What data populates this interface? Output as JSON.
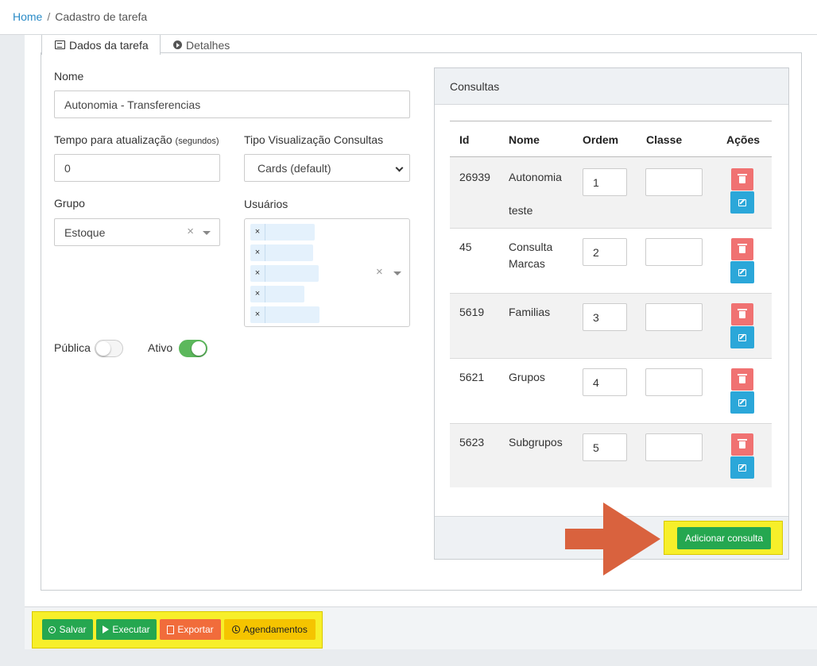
{
  "breadcrumb": {
    "home": "Home",
    "separator": "/",
    "current": "Cadastro de tarefa"
  },
  "tabs": [
    {
      "label": "Dados da tarefa",
      "icon": "list-icon",
      "active": true
    },
    {
      "label": "Detalhes",
      "icon": "play-circle-icon",
      "active": false
    }
  ],
  "form": {
    "nome_label": "Nome",
    "nome_value": "Autonomia - Transferencias",
    "tempo_label": "Tempo para atualização",
    "tempo_hint": "(segundos)",
    "tempo_value": "0",
    "tipo_label": "Tipo Visualização Consultas",
    "tipo_value": "Cards (default)",
    "grupo_label": "Grupo",
    "grupo_value": "Estoque",
    "usuarios_label": "Usuários",
    "usuarios": [
      "",
      "",
      "",
      "",
      ""
    ],
    "publica_label": "Pública",
    "publica_on": false,
    "ativo_label": "Ativo",
    "ativo_on": true
  },
  "consultas": {
    "title": "Consultas",
    "columns": [
      "Id",
      "Nome",
      "Ordem",
      "Classe",
      "Ações"
    ],
    "rows": [
      {
        "id": "26939",
        "nome": "Autonomia",
        "nome2": "teste",
        "ordem": "1",
        "classe": ""
      },
      {
        "id": "45",
        "nome": "Consulta",
        "nome2": "Marcas",
        "ordem": "2",
        "classe": ""
      },
      {
        "id": "5619",
        "nome": "Familias",
        "nome2": "",
        "ordem": "3",
        "classe": ""
      },
      {
        "id": "5621",
        "nome": "Grupos",
        "nome2": "",
        "ordem": "4",
        "classe": ""
      },
      {
        "id": "5623",
        "nome": "Subgrupos",
        "nome2": "",
        "ordem": "5",
        "classe": ""
      }
    ],
    "add_button": "Adicionar consulta"
  },
  "footer": {
    "salvar": "Salvar",
    "executar": "Executar",
    "exportar": "Exportar",
    "agendamentos": "Agendamentos"
  },
  "colors": {
    "link": "#2a8bc7",
    "success": "#25a750",
    "danger": "#f07272",
    "info": "#2ba7d9",
    "warning": "#f5c400",
    "orange": "#f16c3b",
    "highlight": "#f7ef2a",
    "arrow": "#d9623e"
  }
}
